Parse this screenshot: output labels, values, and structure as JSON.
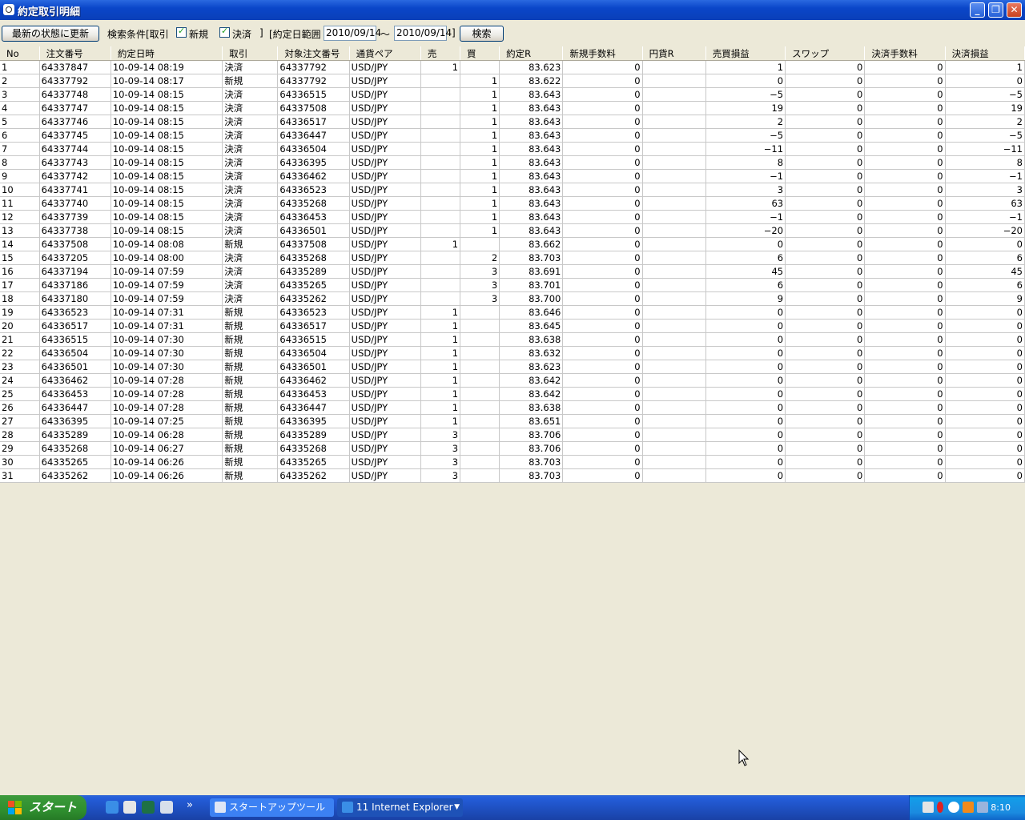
{
  "window": {
    "title": "約定取引明細"
  },
  "toolbar": {
    "refresh_label": "最新の状態に更新",
    "search_cond_label": "検索条件[取引",
    "new_label": "新規",
    "settle_label": "決済",
    "bracket_close1": "]",
    "date_range_label": "[約定日範囲",
    "date_from": "2010/09/14",
    "tilde": "～",
    "date_to": "2010/09/14",
    "bracket_close2": "]",
    "search_label": "検索"
  },
  "table": {
    "columns": [
      "No",
      "注文番号",
      "約定日時",
      "取引",
      "対象注文番号",
      "通貨ペア",
      "売",
      "買",
      "約定R",
      "新規手数料",
      "円貨R",
      "売買損益",
      "スワップ",
      "決済手数料",
      "決済損益"
    ],
    "rows": [
      [
        "1",
        "64337847",
        "10-09-14 08:19",
        "決済",
        "64337792",
        "USD/JPY",
        "1",
        "",
        "83.623",
        "0",
        "",
        "1",
        "0",
        "0",
        "1"
      ],
      [
        "2",
        "64337792",
        "10-09-14 08:17",
        "新規",
        "64337792",
        "USD/JPY",
        "",
        "1",
        "83.622",
        "0",
        "",
        "0",
        "0",
        "0",
        "0"
      ],
      [
        "3",
        "64337748",
        "10-09-14 08:15",
        "決済",
        "64336515",
        "USD/JPY",
        "",
        "1",
        "83.643",
        "0",
        "",
        "−5",
        "0",
        "0",
        "−5"
      ],
      [
        "4",
        "64337747",
        "10-09-14 08:15",
        "決済",
        "64337508",
        "USD/JPY",
        "",
        "1",
        "83.643",
        "0",
        "",
        "19",
        "0",
        "0",
        "19"
      ],
      [
        "5",
        "64337746",
        "10-09-14 08:15",
        "決済",
        "64336517",
        "USD/JPY",
        "",
        "1",
        "83.643",
        "0",
        "",
        "2",
        "0",
        "0",
        "2"
      ],
      [
        "6",
        "64337745",
        "10-09-14 08:15",
        "決済",
        "64336447",
        "USD/JPY",
        "",
        "1",
        "83.643",
        "0",
        "",
        "−5",
        "0",
        "0",
        "−5"
      ],
      [
        "7",
        "64337744",
        "10-09-14 08:15",
        "決済",
        "64336504",
        "USD/JPY",
        "",
        "1",
        "83.643",
        "0",
        "",
        "−11",
        "0",
        "0",
        "−11"
      ],
      [
        "8",
        "64337743",
        "10-09-14 08:15",
        "決済",
        "64336395",
        "USD/JPY",
        "",
        "1",
        "83.643",
        "0",
        "",
        "8",
        "0",
        "0",
        "8"
      ],
      [
        "9",
        "64337742",
        "10-09-14 08:15",
        "決済",
        "64336462",
        "USD/JPY",
        "",
        "1",
        "83.643",
        "0",
        "",
        "−1",
        "0",
        "0",
        "−1"
      ],
      [
        "10",
        "64337741",
        "10-09-14 08:15",
        "決済",
        "64336523",
        "USD/JPY",
        "",
        "1",
        "83.643",
        "0",
        "",
        "3",
        "0",
        "0",
        "3"
      ],
      [
        "11",
        "64337740",
        "10-09-14 08:15",
        "決済",
        "64335268",
        "USD/JPY",
        "",
        "1",
        "83.643",
        "0",
        "",
        "63",
        "0",
        "0",
        "63"
      ],
      [
        "12",
        "64337739",
        "10-09-14 08:15",
        "決済",
        "64336453",
        "USD/JPY",
        "",
        "1",
        "83.643",
        "0",
        "",
        "−1",
        "0",
        "0",
        "−1"
      ],
      [
        "13",
        "64337738",
        "10-09-14 08:15",
        "決済",
        "64336501",
        "USD/JPY",
        "",
        "1",
        "83.643",
        "0",
        "",
        "−20",
        "0",
        "0",
        "−20"
      ],
      [
        "14",
        "64337508",
        "10-09-14 08:08",
        "新規",
        "64337508",
        "USD/JPY",
        "1",
        "",
        "83.662",
        "0",
        "",
        "0",
        "0",
        "0",
        "0"
      ],
      [
        "15",
        "64337205",
        "10-09-14 08:00",
        "決済",
        "64335268",
        "USD/JPY",
        "",
        "2",
        "83.703",
        "0",
        "",
        "6",
        "0",
        "0",
        "6"
      ],
      [
        "16",
        "64337194",
        "10-09-14 07:59",
        "決済",
        "64335289",
        "USD/JPY",
        "",
        "3",
        "83.691",
        "0",
        "",
        "45",
        "0",
        "0",
        "45"
      ],
      [
        "17",
        "64337186",
        "10-09-14 07:59",
        "決済",
        "64335265",
        "USD/JPY",
        "",
        "3",
        "83.701",
        "0",
        "",
        "6",
        "0",
        "0",
        "6"
      ],
      [
        "18",
        "64337180",
        "10-09-14 07:59",
        "決済",
        "64335262",
        "USD/JPY",
        "",
        "3",
        "83.700",
        "0",
        "",
        "9",
        "0",
        "0",
        "9"
      ],
      [
        "19",
        "64336523",
        "10-09-14 07:31",
        "新規",
        "64336523",
        "USD/JPY",
        "1",
        "",
        "83.646",
        "0",
        "",
        "0",
        "0",
        "0",
        "0"
      ],
      [
        "20",
        "64336517",
        "10-09-14 07:31",
        "新規",
        "64336517",
        "USD/JPY",
        "1",
        "",
        "83.645",
        "0",
        "",
        "0",
        "0",
        "0",
        "0"
      ],
      [
        "21",
        "64336515",
        "10-09-14 07:30",
        "新規",
        "64336515",
        "USD/JPY",
        "1",
        "",
        "83.638",
        "0",
        "",
        "0",
        "0",
        "0",
        "0"
      ],
      [
        "22",
        "64336504",
        "10-09-14 07:30",
        "新規",
        "64336504",
        "USD/JPY",
        "1",
        "",
        "83.632",
        "0",
        "",
        "0",
        "0",
        "0",
        "0"
      ],
      [
        "23",
        "64336501",
        "10-09-14 07:30",
        "新規",
        "64336501",
        "USD/JPY",
        "1",
        "",
        "83.623",
        "0",
        "",
        "0",
        "0",
        "0",
        "0"
      ],
      [
        "24",
        "64336462",
        "10-09-14 07:28",
        "新規",
        "64336462",
        "USD/JPY",
        "1",
        "",
        "83.642",
        "0",
        "",
        "0",
        "0",
        "0",
        "0"
      ],
      [
        "25",
        "64336453",
        "10-09-14 07:28",
        "新規",
        "64336453",
        "USD/JPY",
        "1",
        "",
        "83.642",
        "0",
        "",
        "0",
        "0",
        "0",
        "0"
      ],
      [
        "26",
        "64336447",
        "10-09-14 07:28",
        "新規",
        "64336447",
        "USD/JPY",
        "1",
        "",
        "83.638",
        "0",
        "",
        "0",
        "0",
        "0",
        "0"
      ],
      [
        "27",
        "64336395",
        "10-09-14 07:25",
        "新規",
        "64336395",
        "USD/JPY",
        "1",
        "",
        "83.651",
        "0",
        "",
        "0",
        "0",
        "0",
        "0"
      ],
      [
        "28",
        "64335289",
        "10-09-14 06:28",
        "新規",
        "64335289",
        "USD/JPY",
        "3",
        "",
        "83.706",
        "0",
        "",
        "0",
        "0",
        "0",
        "0"
      ],
      [
        "29",
        "64335268",
        "10-09-14 06:27",
        "新規",
        "64335268",
        "USD/JPY",
        "3",
        "",
        "83.706",
        "0",
        "",
        "0",
        "0",
        "0",
        "0"
      ],
      [
        "30",
        "64335265",
        "10-09-14 06:26",
        "新規",
        "64335265",
        "USD/JPY",
        "3",
        "",
        "83.703",
        "0",
        "",
        "0",
        "0",
        "0",
        "0"
      ],
      [
        "31",
        "64335262",
        "10-09-14 06:26",
        "新規",
        "64335262",
        "USD/JPY",
        "3",
        "",
        "83.703",
        "0",
        "",
        "0",
        "0",
        "0",
        "0"
      ]
    ]
  },
  "taskbar": {
    "start_label": "スタート",
    "overflow": "»",
    "tasks": [
      {
        "label": "スタートアップツール"
      },
      {
        "label": "11 Internet Explorer"
      }
    ],
    "clock": "8:10"
  }
}
